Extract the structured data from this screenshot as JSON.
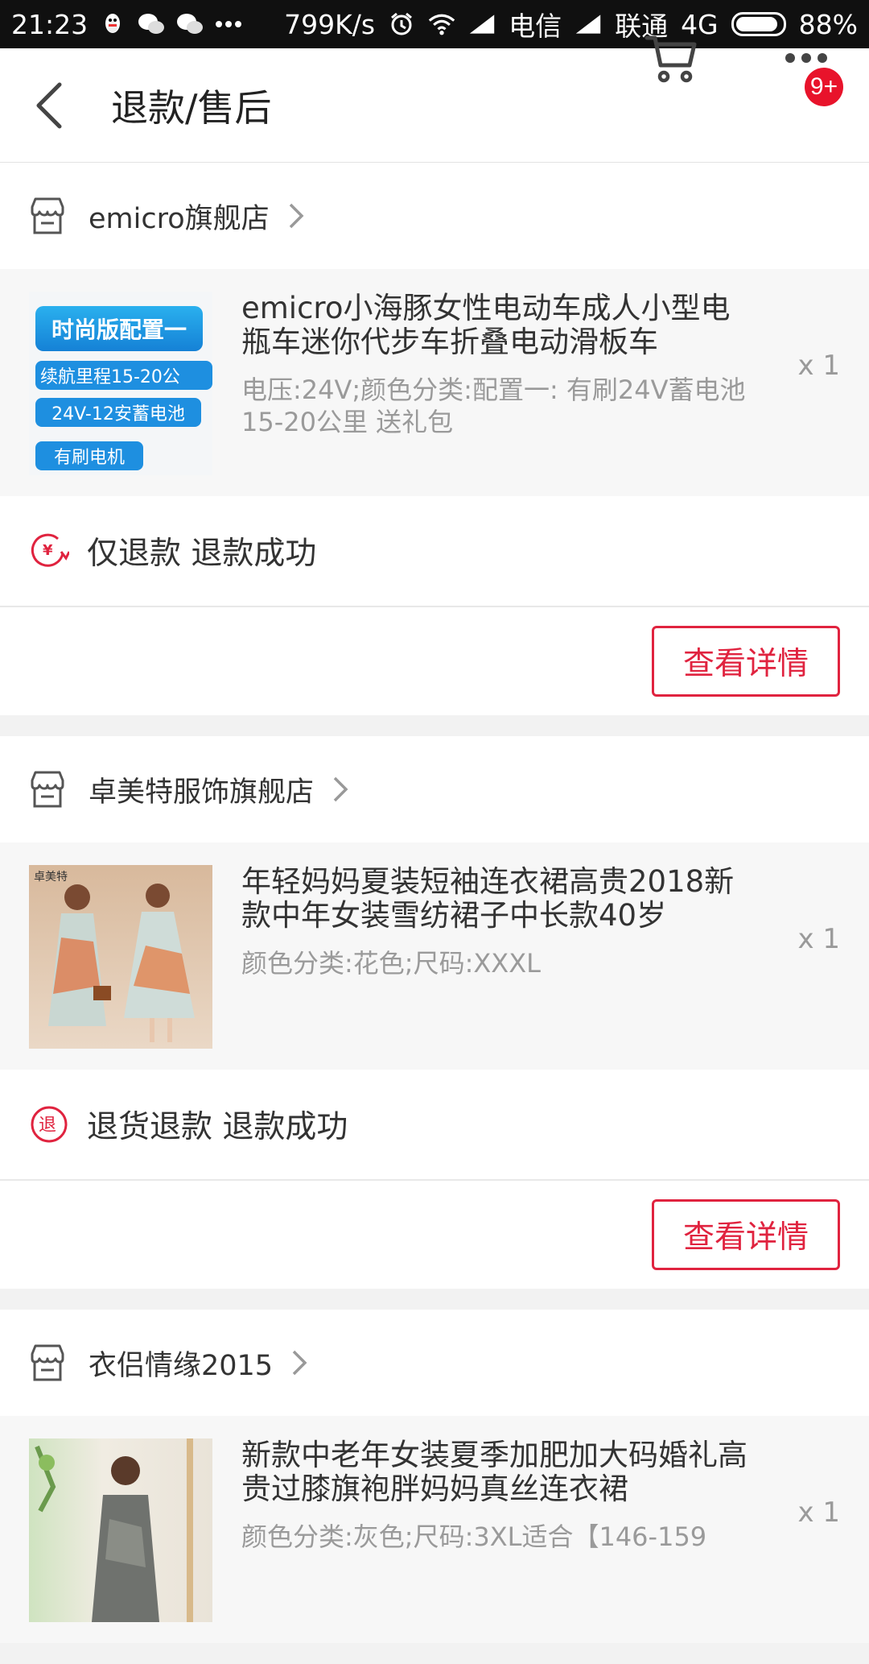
{
  "status_bar": {
    "time": "21:23",
    "speed": "799K/s",
    "carrier1": "电信",
    "carrier2": "联通",
    "network": "4G",
    "battery": "88%"
  },
  "header": {
    "title": "退款/售后",
    "badge": "9+"
  },
  "orders": [
    {
      "shop": "emicro旗舰店",
      "title": "emicro小海豚女性电动车成人小型电瓶车迷你代步车折叠电动滑板车",
      "spec": "电压:24V;颜色分类:配置一: 有刷24V蓄电池 15-20公里 送礼包",
      "qty": "x 1",
      "status": "仅退款 退款成功",
      "button": "查看详情",
      "thumb_lines": [
        "时尚版配置一",
        "续航里程15-20公",
        "24V-12安蓄电池",
        "有刷电机"
      ]
    },
    {
      "shop": "卓美特服饰旗舰店",
      "title": "年轻妈妈夏装短袖连衣裙高贵2018新款中年女装雪纺裙子中长款40岁",
      "spec": "颜色分类:花色;尺码:XXXL",
      "qty": "x 1",
      "status": "退货退款 退款成功",
      "button": "查看详情",
      "thumb_brand": "卓美特"
    },
    {
      "shop": "衣侣情缘2015",
      "title": "新款中老年女装夏季加肥加大码婚礼高贵过膝旗袍胖妈妈真丝连衣裙",
      "spec": "颜色分类:灰色;尺码:3XL适合【146-159",
      "qty": "x 1"
    }
  ],
  "colors": {
    "accent": "#e0233f",
    "badge": "#e8132b"
  }
}
